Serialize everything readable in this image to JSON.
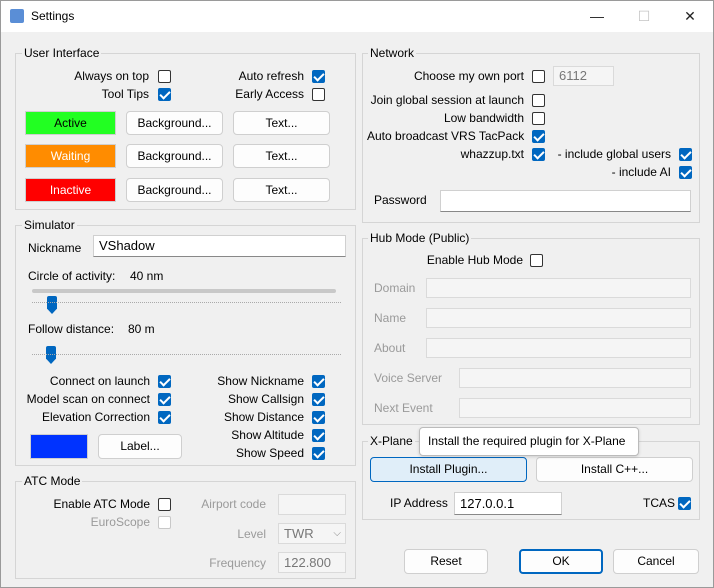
{
  "window": {
    "title": "Settings",
    "minimize": "—",
    "maximize": "☐",
    "close": "✕"
  },
  "ui": {
    "group": "User Interface",
    "always_on_top": {
      "label": "Always on top",
      "checked": false
    },
    "tool_tips": {
      "label": "Tool Tips",
      "checked": true
    },
    "auto_refresh": {
      "label": "Auto refresh",
      "checked": true
    },
    "early_access": {
      "label": "Early Access",
      "checked": false
    },
    "rows": [
      {
        "swatch": "Active",
        "color": "#22ff22",
        "bg_btn": "Background...",
        "text_btn": "Text..."
      },
      {
        "swatch": "Waiting",
        "color": "#ff8c00",
        "bg_btn": "Background...",
        "text_btn": "Text..."
      },
      {
        "swatch": "Inactive",
        "color": "#ff0000",
        "bg_btn": "Background...",
        "text_btn": "Text..."
      }
    ]
  },
  "simulator": {
    "group": "Simulator",
    "nickname_label": "Nickname",
    "nickname_value": "VShadow",
    "circle_label": "Circle of activity:",
    "circle_value": "40 nm",
    "circle_level": 0.08,
    "follow_label": "Follow distance:",
    "follow_value": "80 m",
    "follow_level": 0.07,
    "connect_on_launch": {
      "label": "Connect on launch",
      "checked": true
    },
    "model_scan": {
      "label": "Model scan on connect",
      "checked": true
    },
    "elevation": {
      "label": "Elevation Correction",
      "checked": true
    },
    "show_nickname": {
      "label": "Show Nickname",
      "checked": true
    },
    "show_callsign": {
      "label": "Show Callsign",
      "checked": true
    },
    "show_distance": {
      "label": "Show Distance",
      "checked": true
    },
    "show_altitude": {
      "label": "Show Altitude",
      "checked": true
    },
    "show_speed": {
      "label": "Show Speed",
      "checked": true
    },
    "label_color": "#0033ff",
    "label_btn": "Label..."
  },
  "atc": {
    "group": "ATC Mode",
    "enable_label": "Enable ATC Mode",
    "euroscope_label": "EuroScope",
    "airport_label": "Airport code",
    "level_label": "Level",
    "level_value": "TWR",
    "frequency_label": "Frequency",
    "frequency_value": "122.800"
  },
  "network": {
    "group": "Network",
    "own_port": {
      "label": "Choose my own port",
      "checked": false,
      "value": "6112"
    },
    "join_global": {
      "label": "Join global session at launch",
      "checked": false
    },
    "low_bandwidth": {
      "label": "Low bandwidth",
      "checked": false
    },
    "auto_broadcast": {
      "label": "Auto broadcast VRS TacPack",
      "checked": true
    },
    "whazzup": {
      "label": "whazzup.txt",
      "checked": true
    },
    "include_global": {
      "label": "- include global users",
      "checked": true
    },
    "include_ai": {
      "label": "- include AI",
      "checked": true
    },
    "password_label": "Password",
    "password_value": ""
  },
  "hub": {
    "group": "Hub Mode (Public)",
    "enable_label": "Enable Hub Mode",
    "domain_label": "Domain",
    "name_label": "Name",
    "about_label": "About",
    "voice_label": "Voice Server",
    "next_event_label": "Next Event"
  },
  "xplane": {
    "group": "X-Plane",
    "install_plugin": "Install Plugin...",
    "install_cpp": "Install C++...",
    "tooltip": "Install the required plugin for X-Plane",
    "ip_label": "IP Address",
    "ip_value": "127.0.0.1",
    "tcas_label": "TCAS",
    "tcas_checked": true
  },
  "footer": {
    "reset": "Reset",
    "ok": "OK",
    "cancel": "Cancel"
  }
}
